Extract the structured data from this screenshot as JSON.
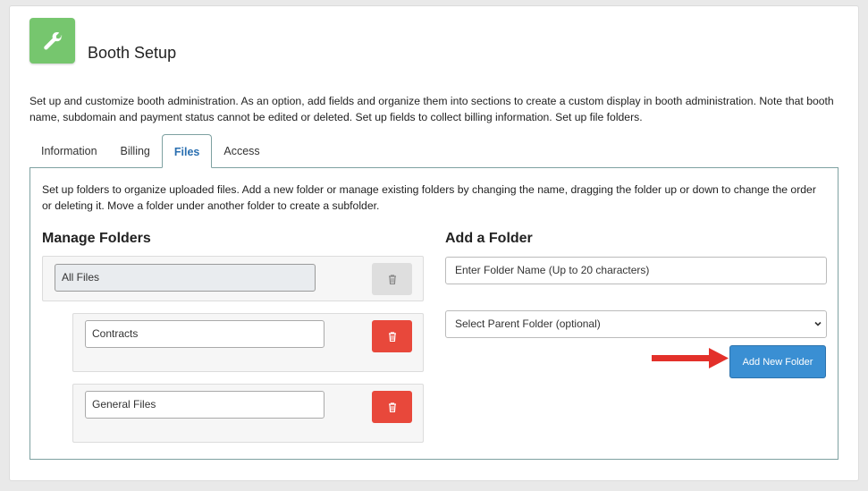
{
  "header": {
    "title": "Booth Setup",
    "icon": "wrench-icon",
    "icon_color": "#76c66e"
  },
  "intro_text": "Set up and customize booth administration. As an option, add fields and organize them into sections to create a custom display in booth administration. Note that booth name, subdomain and payment status cannot be edited or deleted. Set up fields to collect billing information. Set up file folders.",
  "tabs": [
    {
      "label": "Information",
      "active": false
    },
    {
      "label": "Billing",
      "active": false
    },
    {
      "label": "Files",
      "active": true
    },
    {
      "label": "Access",
      "active": false
    }
  ],
  "files_panel": {
    "description": "Set up folders to organize uploaded files. Add a new folder or manage existing folders by changing the name, dragging the folder up or down to change the order or deleting it. Move a folder under another folder to create a subfolder.",
    "manage": {
      "title": "Manage Folders",
      "root_folder": "All Files",
      "subfolders": [
        "Contracts",
        "General Files"
      ]
    },
    "add": {
      "title": "Add a Folder",
      "name_placeholder": "Enter Folder Name (Up to 20 characters)",
      "parent_select": "Select Parent Folder (optional)",
      "button_label": "Add New Folder"
    }
  },
  "colors": {
    "accent": "#3a8fd3",
    "delete": "#e8483b",
    "tab_active": "#2a6fb0",
    "annotation_arrow": "#e3302a"
  }
}
